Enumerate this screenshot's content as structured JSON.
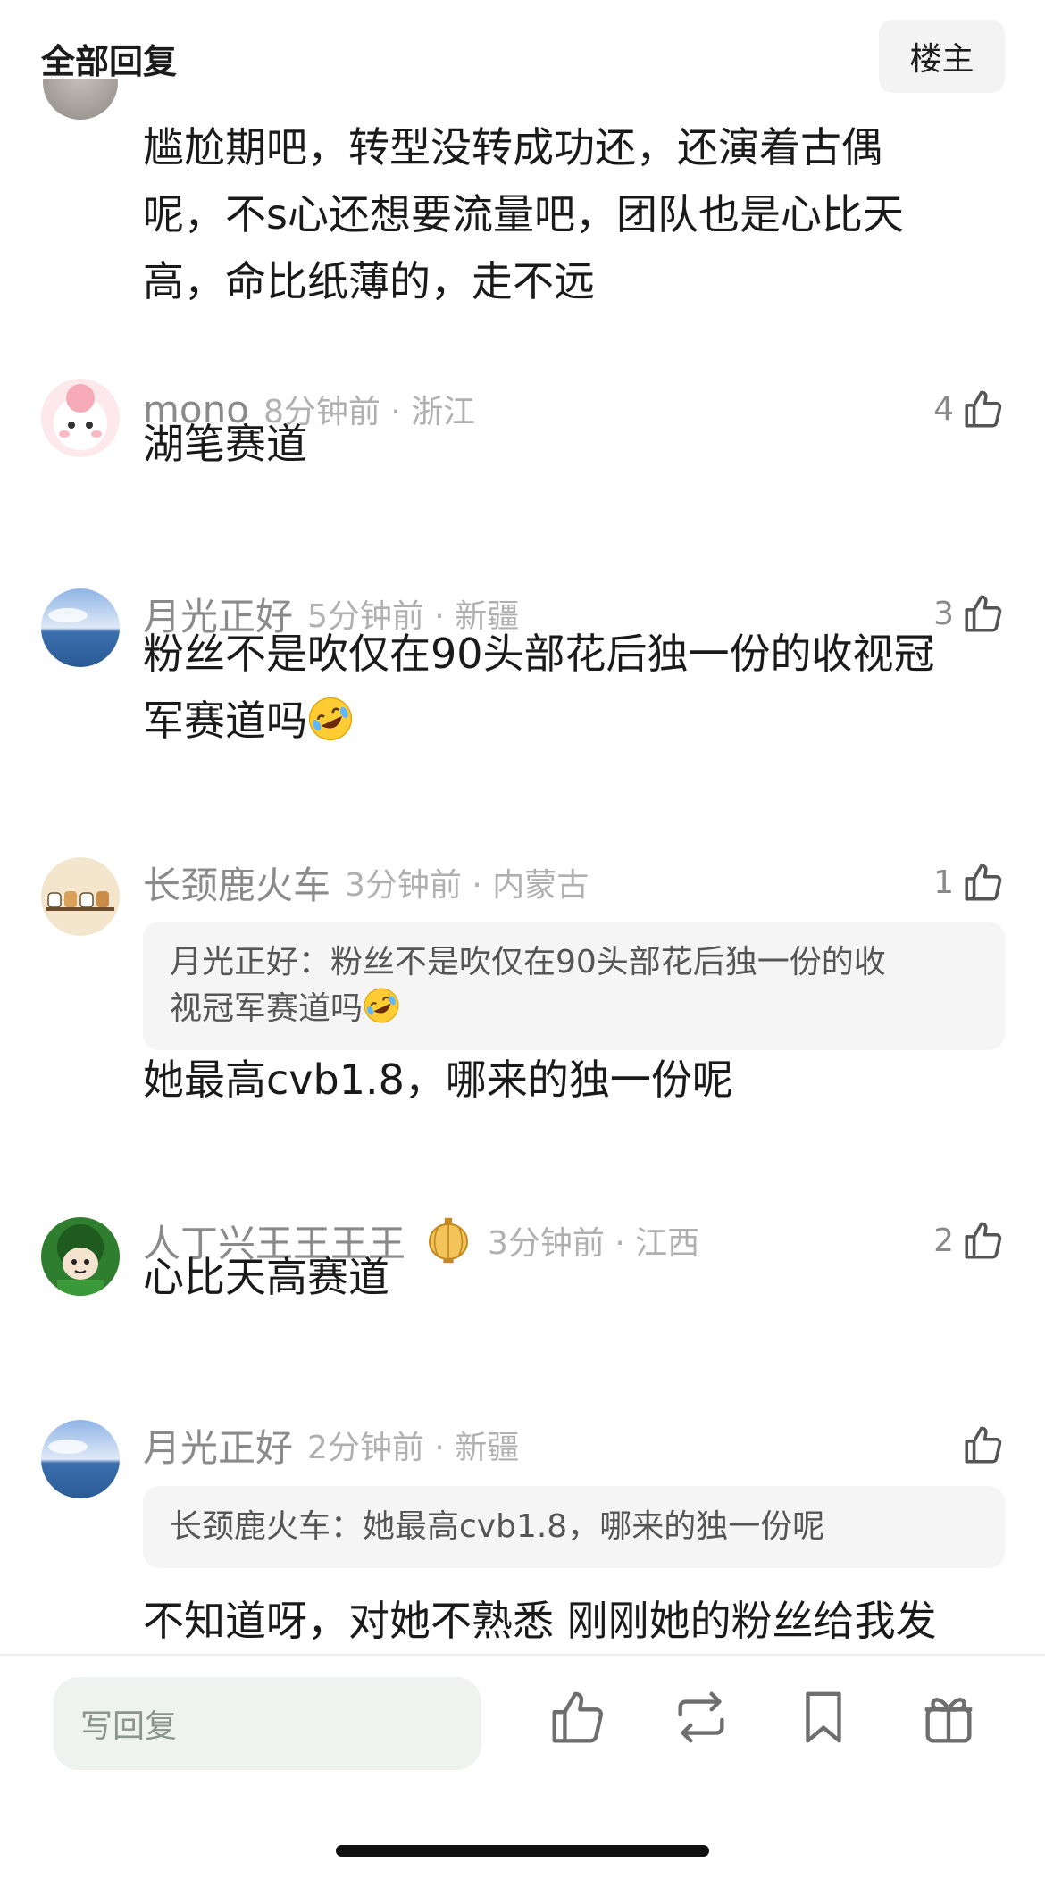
{
  "header": {
    "title": "全部回复",
    "op_button": "楼主"
  },
  "top_comment": {
    "lines": [
      "尴尬期吧，转型没转成功还，还演着古偶",
      "呢，不s心还想要流量吧，团队也是心比天",
      "高，命比纸薄的，走不远"
    ]
  },
  "comments": [
    {
      "username": "mono",
      "time_loc": "8分钟前 · 浙江",
      "likes": "4",
      "body": [
        "湖笔赛道"
      ]
    },
    {
      "username": "月光正好",
      "time_loc": "5分钟前 · 新疆",
      "likes": "3",
      "body": [
        "粉丝不是吹仅在90头部花后独一份的收视冠",
        "军赛道吗"
      ],
      "emoji": "rofl-emoji"
    },
    {
      "username": "长颈鹿火车",
      "time_loc": "3分钟前 · 内蒙古",
      "likes": "1",
      "quote": [
        "月光正好：粉丝不是吹仅在90头部花后独一份的收",
        "视冠军赛道吗"
      ],
      "body": [
        "她最高cvb1.8，哪来的独一份呢"
      ]
    },
    {
      "username": "人丁兴王王王王",
      "badge": "lantern-badge-icon",
      "time_loc": "3分钟前 · 江西",
      "likes": "2",
      "body": [
        "心比天高赛道"
      ]
    },
    {
      "username": "月光正好",
      "time_loc": "2分钟前 · 新疆",
      "likes": "",
      "quote": [
        "长颈鹿火车：她最高cvb1.8，哪来的独一份呢"
      ],
      "body": [
        "不知道呀，对她不熟悉 刚刚她的粉丝给我发"
      ]
    }
  ],
  "bottom_bar": {
    "reply_placeholder": "写回复",
    "actions": [
      "thumbs-up-icon",
      "repost-icon",
      "bookmark-icon",
      "gift-icon"
    ]
  },
  "colors": {
    "muted": "#8a8a8a",
    "quote_bg": "#f5f5f5",
    "input_bg": "#eef3ef"
  }
}
